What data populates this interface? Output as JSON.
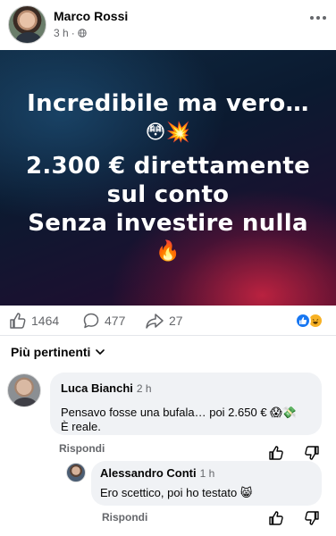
{
  "post": {
    "author": "Marco Rossi",
    "time": "3 h",
    "more_icon": "more-horizontal-icon",
    "banner": {
      "line1": "Incredibile ma vero…",
      "emojis1": "😳💥",
      "line2": "2.300 € direttamente",
      "line3": "sul conto",
      "line4": "Senza investire nulla",
      "emojis2": "🔥"
    },
    "stats": {
      "likes": "1464",
      "comments": "477",
      "shares": "27"
    }
  },
  "sort": {
    "label": "Più pertinenti"
  },
  "comments": [
    {
      "author": "Luca Bianchi",
      "time": "2 h",
      "line1": "Pensavo fosse una bufala… poi 2.650 € 😱💸",
      "line2": "È reale.",
      "reply_label": "Rispondi"
    },
    {
      "author": "Alessandro Conti",
      "time": "1 h",
      "text": "Ero scettico, poi ho testato 😸",
      "reply_label": "Rispondi"
    }
  ],
  "colors": {
    "accent": "#1877f2",
    "muted_text": "#65676b",
    "bubble": "#f0f2f5"
  }
}
